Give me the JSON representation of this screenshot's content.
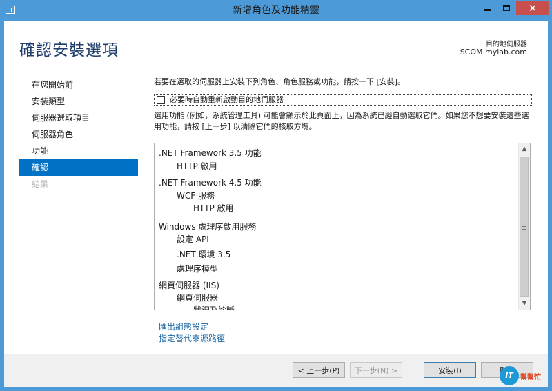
{
  "window": {
    "title": "新增角色及功能精靈",
    "title_bar_color": "#4d9ad9",
    "close_color": "#c7504d"
  },
  "header": {
    "page_title": "確認安裝選項",
    "destination_label": "目的地伺服器",
    "destination_server": "SCOM.mylab.com"
  },
  "nav": {
    "items": [
      {
        "label": "在您開始前",
        "state": "normal"
      },
      {
        "label": "安裝類型",
        "state": "normal"
      },
      {
        "label": "伺服器選取項目",
        "state": "normal"
      },
      {
        "label": "伺服器角色",
        "state": "normal"
      },
      {
        "label": "功能",
        "state": "normal"
      },
      {
        "label": "確認",
        "state": "active"
      },
      {
        "label": "結果",
        "state": "disabled"
      }
    ],
    "active_color": "#0071c5"
  },
  "main": {
    "intro": "若要在選取的伺服器上安裝下列角色、角色服務或功能，請按一下 [安裝]。",
    "restart_checkbox": {
      "label": "必要時自動重新啟動目的地伺服器",
      "checked": false
    },
    "note": "選用功能 (例如，系統管理工具) 可能會顯示於此頁面上，因為系統已經自動選取它們。如果您不想要安裝這些選用功能，請按 [上一步] 以清除它們的核取方塊。",
    "items": [
      {
        "label": ".NET Framework 3.5 功能",
        "level": 0
      },
      {
        "label": "HTTP 啟用",
        "level": 1
      },
      {
        "label": ".NET Framework 4.5 功能",
        "level": 0
      },
      {
        "label": "WCF 服務",
        "level": 1
      },
      {
        "label": "HTTP 啟用",
        "level": 2
      },
      {
        "label": "Windows 處理序啟用服務",
        "level": 0
      },
      {
        "label": "設定 API",
        "level": 1
      },
      {
        "label": ".NET 環境 3.5",
        "level": 1
      },
      {
        "label": "處理序模型",
        "level": 1
      },
      {
        "label": "網頁伺服器 (IIS)",
        "level": 0
      },
      {
        "label": "網頁伺服器",
        "level": 1
      },
      {
        "label": "狀況及診斷",
        "level": 2
      }
    ],
    "links": {
      "export": "匯出組態設定",
      "alternate_source": "指定替代來源路徑"
    }
  },
  "footer": {
    "prev": "< 上一步(P)",
    "next": "下一步(N) >",
    "install": "安裝(I)",
    "cancel": "取消"
  },
  "watermark": {
    "badge": "IT",
    "text": "幫幫忙"
  }
}
